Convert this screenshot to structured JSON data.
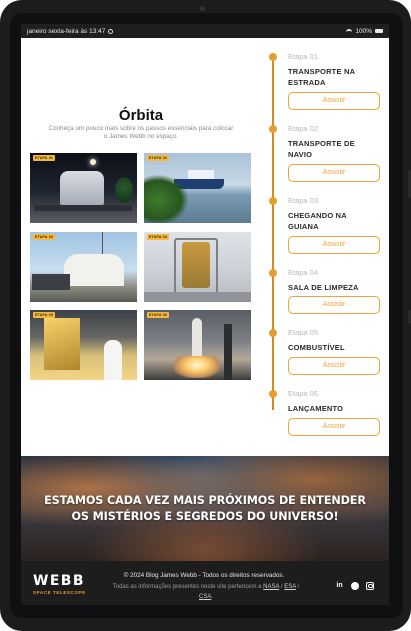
{
  "status_bar": {
    "datetime": "janeiro sexta-feira às 13:47",
    "battery": "100%"
  },
  "orbita": {
    "title": "Órbita",
    "subtitle": "Conheça um pouco mais sobre os passos essenciais para colocar o James Webb no espaço."
  },
  "photos": [
    {
      "tag": "ETAPA 01",
      "icon": "transport-truck-photo"
    },
    {
      "tag": "ETAPA 02",
      "icon": "ship-photo"
    },
    {
      "tag": "ETAPA 03",
      "icon": "hangar-photo"
    },
    {
      "tag": "ETAPA 04",
      "icon": "clean-room-photo"
    },
    {
      "tag": "ETAPA 05",
      "icon": "fuel-photo"
    },
    {
      "tag": "ETAPA 06",
      "icon": "launch-photo"
    }
  ],
  "timeline": [
    {
      "step": "Etapa 01",
      "name": "TRANSPORTE NA ESTRADA",
      "button": "Assistir"
    },
    {
      "step": "Etapa 02",
      "name": "TRANSPORTE DE NAVIO",
      "button": "Assistir"
    },
    {
      "step": "Etapa 03",
      "name": "CHEGANDO NA GUIANA",
      "button": "Assistir"
    },
    {
      "step": "Etapa 04",
      "name": "SALA DE LIMPEZA",
      "button": "Assistir"
    },
    {
      "step": "Etapa 05",
      "name": "COMBUSTÍVEL",
      "button": "Assistir"
    },
    {
      "step": "Etapa 06",
      "name": "LANÇAMENTO",
      "button": "Assistir"
    }
  ],
  "banner": {
    "text": "ESTAMOS CADA VEZ MAIS PRÓXIMOS DE ENTENDER OS MISTÉRIOS E SEGREDOS DO UNIVERSO!"
  },
  "footer": {
    "logo": "WEBB",
    "logo_sub": "SPACE TELESCOPE",
    "copyright": "© 2024 Blog James Webb - Todos os direitos reservados.",
    "note_prefix": "Todas as informações presentes neste site pertencem a",
    "link_nasa": "NASA",
    "link_esa": "ESA",
    "link_csa": "CSA",
    "sep": "/",
    "end": ".",
    "social": [
      "linkedin-icon",
      "github-icon",
      "instagram-icon"
    ],
    "linkedin_glyph": "in"
  },
  "colors": {
    "accent": "#e79c2e",
    "footer_bg": "#1d1d1d"
  }
}
